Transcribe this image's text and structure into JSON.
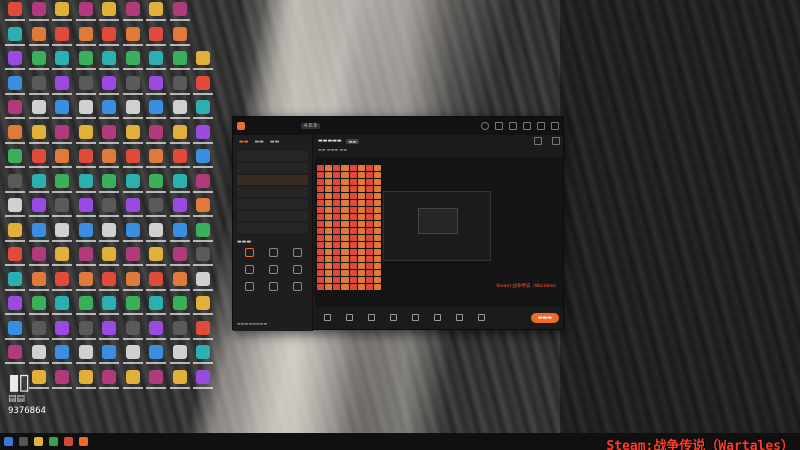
{
  "overlay": {
    "viewer_count": "9376864",
    "stream_caption": "Steam:战争传说（Wartales）"
  },
  "app": {
    "version_badge": "4.8.9"
  },
  "colors": {
    "accent": "#f06a2b",
    "caption_red": "#ff3c2a"
  }
}
